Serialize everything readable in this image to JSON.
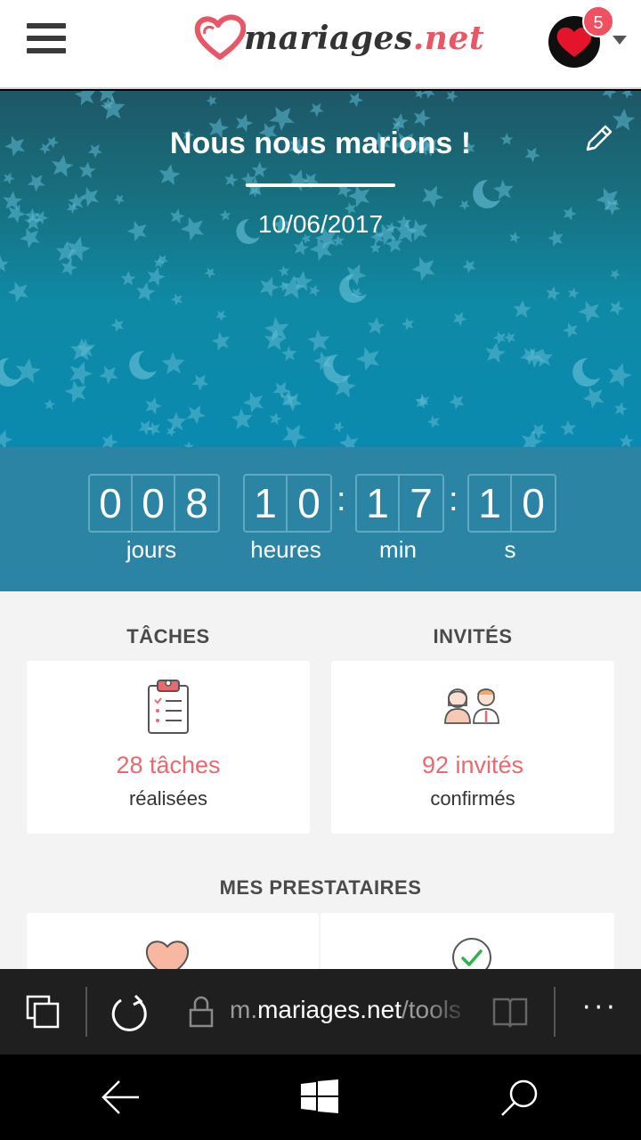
{
  "header": {
    "logo_text": "mariages",
    "logo_dot": ".net",
    "notification_count": "5"
  },
  "hero": {
    "title": "Nous nous marions !",
    "date": "10/06/2017"
  },
  "countdown": {
    "days": [
      "0",
      "0",
      "8"
    ],
    "hours": [
      "1",
      "0"
    ],
    "minutes": [
      "1",
      "7"
    ],
    "seconds": [
      "1",
      "0"
    ],
    "labels": {
      "days": "jours",
      "hours": "heures",
      "minutes": "min",
      "seconds": "s"
    }
  },
  "tasks": {
    "title": "TÂCHES",
    "count": "28 tâches",
    "sub": "réalisées"
  },
  "guests": {
    "title": "INVITÉS",
    "count": "92 invités",
    "sub": "confirmés"
  },
  "vendors": {
    "title": "MES PRESTATAIRES"
  },
  "browser": {
    "url_prefix": "m.",
    "url_host": "mariages.net",
    "url_path": "/tools"
  },
  "colors": {
    "accent": "#e95665",
    "countdown_bg": "#2b84a3",
    "count_text": "#e86a6e"
  }
}
